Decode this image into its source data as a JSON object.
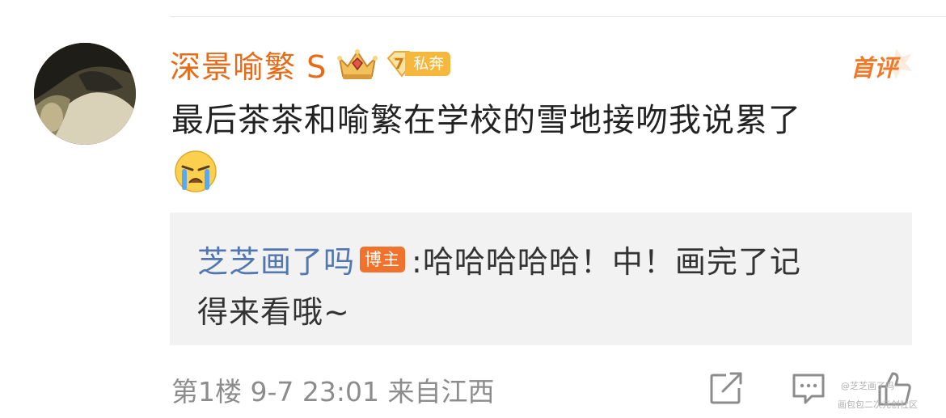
{
  "comment": {
    "username": "深景喻繁 S",
    "level_number": "7",
    "level_tag": "私奔",
    "first_comment_label": "首评",
    "text": "最后茶茶和喻繁在学校的雪地接吻我说累了",
    "emoji_name": "crying-face"
  },
  "reply": {
    "username": "芝芝画了吗",
    "badge": "博主",
    "line1": ":哈哈哈哈哈！中！画完了记",
    "line2": "得来看哦~"
  },
  "meta": {
    "text": "第1楼 9-7 23:01 来自江西"
  },
  "watermark": {
    "line1": "@芝芝画了吗",
    "line2": "画包包二次元创社区"
  },
  "colors": {
    "username": "#e86a17",
    "reply_username": "#5277b0",
    "blogger_badge": "#f0722c",
    "reply_background": "#f2f2f2",
    "meta_text": "#8c8c8c"
  }
}
